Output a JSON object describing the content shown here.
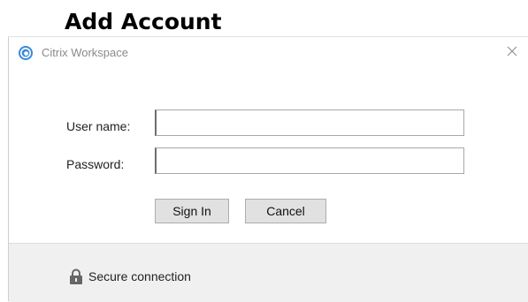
{
  "page": {
    "heading": "Add Account"
  },
  "window": {
    "title": "Citrix Workspace",
    "app_icon": "citrix-workspace-icon",
    "close_icon": "close-icon"
  },
  "form": {
    "username": {
      "label": "User name:",
      "value": ""
    },
    "password": {
      "label": "Password:",
      "value": ""
    },
    "sign_in_label": "Sign In",
    "cancel_label": "Cancel"
  },
  "footer": {
    "lock_icon": "lock-icon",
    "status_text": "Secure connection"
  },
  "colors": {
    "app_icon_blue": "#3a8ad6",
    "title_text": "#8a8a8a",
    "footer_background": "#f0f0f0",
    "button_background": "#e1e1e1"
  }
}
